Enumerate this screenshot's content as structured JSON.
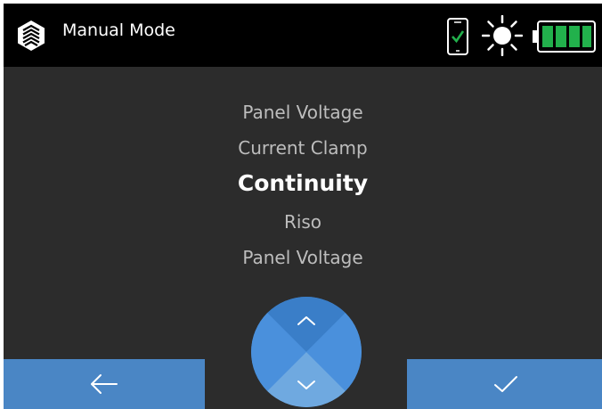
{
  "header": {
    "title": "Manual Mode",
    "icons": [
      "app-logo-icon",
      "phone-connected-icon",
      "brightness-icon",
      "battery-full-icon"
    ]
  },
  "modes": {
    "items": [
      "Panel Voltage",
      "Current Clamp",
      "Continuity",
      "Riso",
      "Panel Voltage"
    ],
    "selected": "Continuity"
  },
  "controls": {
    "back_icon": "arrow-left-icon",
    "confirm_icon": "check-icon",
    "up_icon": "chevron-up-icon",
    "down_icon": "chevron-down-icon"
  },
  "colors": {
    "header_bg": "#000000",
    "screen_bg": "#2c2c2c",
    "button_blue": "#4a86c5",
    "dial_blue": "#4a90dc",
    "dial_blue_dark": "#3a7ec8",
    "dial_blue_light": "#6fa9e0",
    "phone_check_green": "#22b14c",
    "battery_green": "#22b14c"
  }
}
